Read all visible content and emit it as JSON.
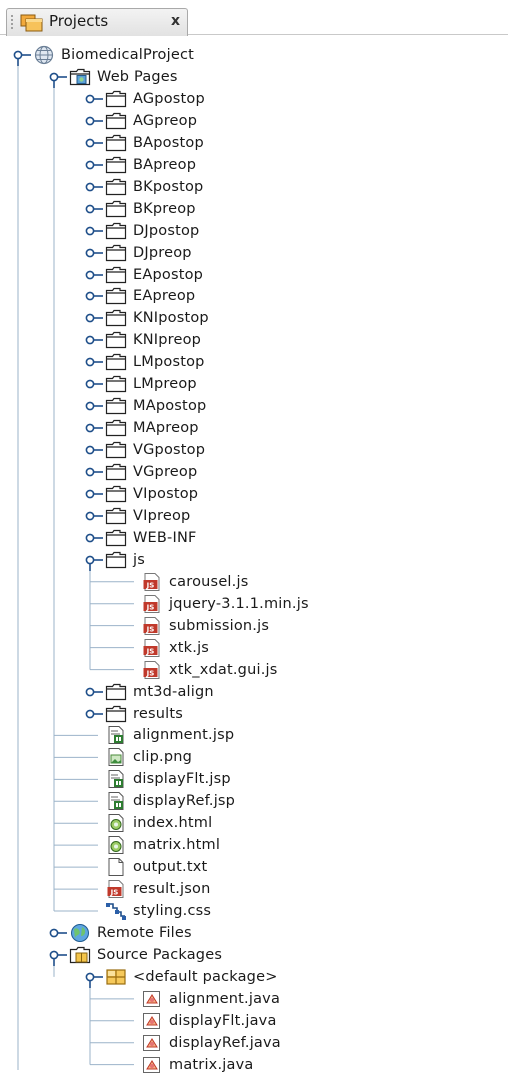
{
  "tab": {
    "label": "Projects",
    "close_glyph": "x",
    "icon": "projects-icon"
  },
  "tree": [
    {
      "label": "BiomedicalProject",
      "level": 0,
      "icon": "globe-project-icon",
      "toggle": "expanded"
    },
    {
      "label": "Web Pages",
      "level": 1,
      "icon": "web-pages-folder-icon",
      "toggle": "expanded"
    },
    {
      "label": "AGpostop",
      "level": 2,
      "icon": "folder-icon",
      "toggle": "collapsed"
    },
    {
      "label": "AGpreop",
      "level": 2,
      "icon": "folder-icon",
      "toggle": "collapsed"
    },
    {
      "label": "BApostop",
      "level": 2,
      "icon": "folder-icon",
      "toggle": "collapsed"
    },
    {
      "label": "BApreop",
      "level": 2,
      "icon": "folder-icon",
      "toggle": "collapsed"
    },
    {
      "label": "BKpostop",
      "level": 2,
      "icon": "folder-icon",
      "toggle": "collapsed"
    },
    {
      "label": "BKpreop",
      "level": 2,
      "icon": "folder-icon",
      "toggle": "collapsed"
    },
    {
      "label": "DJpostop",
      "level": 2,
      "icon": "folder-icon",
      "toggle": "collapsed"
    },
    {
      "label": "DJpreop",
      "level": 2,
      "icon": "folder-icon",
      "toggle": "collapsed"
    },
    {
      "label": "EApostop",
      "level": 2,
      "icon": "folder-icon",
      "toggle": "collapsed"
    },
    {
      "label": "EApreop",
      "level": 2,
      "icon": "folder-icon",
      "toggle": "collapsed"
    },
    {
      "label": "KNIpostop",
      "level": 2,
      "icon": "folder-icon",
      "toggle": "collapsed"
    },
    {
      "label": "KNIpreop",
      "level": 2,
      "icon": "folder-icon",
      "toggle": "collapsed"
    },
    {
      "label": "LMpostop",
      "level": 2,
      "icon": "folder-icon",
      "toggle": "collapsed"
    },
    {
      "label": "LMpreop",
      "level": 2,
      "icon": "folder-icon",
      "toggle": "collapsed"
    },
    {
      "label": "MApostop",
      "level": 2,
      "icon": "folder-icon",
      "toggle": "collapsed"
    },
    {
      "label": "MApreop",
      "level": 2,
      "icon": "folder-icon",
      "toggle": "collapsed"
    },
    {
      "label": "VGpostop",
      "level": 2,
      "icon": "folder-icon",
      "toggle": "collapsed"
    },
    {
      "label": "VGpreop",
      "level": 2,
      "icon": "folder-icon",
      "toggle": "collapsed"
    },
    {
      "label": "VIpostop",
      "level": 2,
      "icon": "folder-icon",
      "toggle": "collapsed"
    },
    {
      "label": "VIpreop",
      "level": 2,
      "icon": "folder-icon",
      "toggle": "collapsed"
    },
    {
      "label": "WEB-INF",
      "level": 2,
      "icon": "folder-icon",
      "toggle": "collapsed"
    },
    {
      "label": "js",
      "level": 2,
      "icon": "folder-icon",
      "toggle": "expanded"
    },
    {
      "label": "carousel.js",
      "level": 3,
      "icon": "js-file-icon",
      "toggle": "none"
    },
    {
      "label": "jquery-3.1.1.min.js",
      "level": 3,
      "icon": "js-file-icon",
      "toggle": "none"
    },
    {
      "label": "submission.js",
      "level": 3,
      "icon": "js-file-icon",
      "toggle": "none"
    },
    {
      "label": "xtk.js",
      "level": 3,
      "icon": "js-file-icon",
      "toggle": "none"
    },
    {
      "label": "xtk_xdat.gui.js",
      "level": 3,
      "icon": "js-file-icon",
      "toggle": "none"
    },
    {
      "label": "mt3d-align",
      "level": 2,
      "icon": "folder-icon",
      "toggle": "collapsed"
    },
    {
      "label": "results",
      "level": 2,
      "icon": "folder-icon",
      "toggle": "collapsed"
    },
    {
      "label": "alignment.jsp",
      "level": 2,
      "icon": "jsp-file-icon",
      "toggle": "none"
    },
    {
      "label": "clip.png",
      "level": 2,
      "icon": "image-file-icon",
      "toggle": "none"
    },
    {
      "label": "displayFlt.jsp",
      "level": 2,
      "icon": "jsp-file-icon",
      "toggle": "none"
    },
    {
      "label": "displayRef.jsp",
      "level": 2,
      "icon": "jsp-file-icon",
      "toggle": "none"
    },
    {
      "label": "index.html",
      "level": 2,
      "icon": "html-file-icon",
      "toggle": "none"
    },
    {
      "label": "matrix.html",
      "level": 2,
      "icon": "html-file-icon",
      "toggle": "none"
    },
    {
      "label": "output.txt",
      "level": 2,
      "icon": "text-file-icon",
      "toggle": "none"
    },
    {
      "label": "result.json",
      "level": 2,
      "icon": "js-file-icon",
      "toggle": "none"
    },
    {
      "label": "styling.css",
      "level": 2,
      "icon": "css-file-icon",
      "toggle": "none"
    },
    {
      "label": "Remote Files",
      "level": 1,
      "icon": "remote-files-globe-icon",
      "toggle": "collapsed"
    },
    {
      "label": "Source Packages",
      "level": 1,
      "icon": "source-packages-icon",
      "toggle": "expanded"
    },
    {
      "label": "<default package>",
      "level": 2,
      "icon": "package-icon",
      "toggle": "expanded"
    },
    {
      "label": "alignment.java",
      "level": 3,
      "icon": "java-file-icon",
      "toggle": "none"
    },
    {
      "label": "displayFlt.java",
      "level": 3,
      "icon": "java-file-icon",
      "toggle": "none"
    },
    {
      "label": "displayRef.java",
      "level": 3,
      "icon": "java-file-icon",
      "toggle": "none"
    },
    {
      "label": "matrix.java",
      "level": 3,
      "icon": "java-file-icon",
      "toggle": "none"
    }
  ],
  "colors": {
    "guide_line": "#9bb3c9",
    "toggle_line": "#1f4f8a",
    "folder_outline": "#222222",
    "js_icon": "#c0392b",
    "jsp_icon": "#2e7d32"
  }
}
